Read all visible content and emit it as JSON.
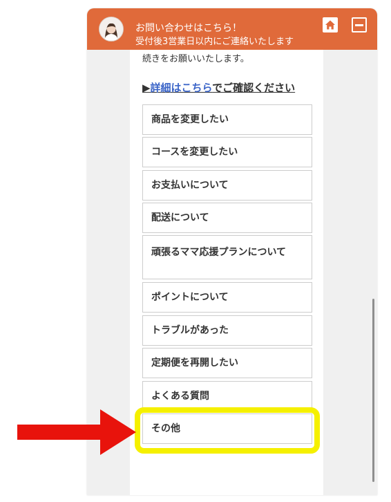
{
  "header": {
    "title": "お問い合わせはこちら！",
    "subtitle": "受付後3営業日以内にご連絡いたします",
    "home_icon": "home-icon",
    "minimize_icon": "minimize-icon",
    "avatar": "agent-avatar",
    "color": "#e06a3a"
  },
  "content": {
    "partial_text": "続きをお願いいたします。",
    "detail_link": {
      "prefix": "▶",
      "link_text": "詳細はこちら",
      "suffix": "でご確認ください",
      "link_color": "#3a64c8"
    },
    "options": [
      "商品を変更したい",
      "コースを変更したい",
      "お支払いについて",
      "配送について",
      "頑張るママ応援プランについて",
      "ポイントについて",
      "トラブルがあった",
      "定期便を再開したい",
      "よくある質問",
      "その他"
    ]
  },
  "annotation": {
    "highlight_color": "#f5f000",
    "arrow_color": "#e8130c",
    "highlighted_option": "その他"
  }
}
